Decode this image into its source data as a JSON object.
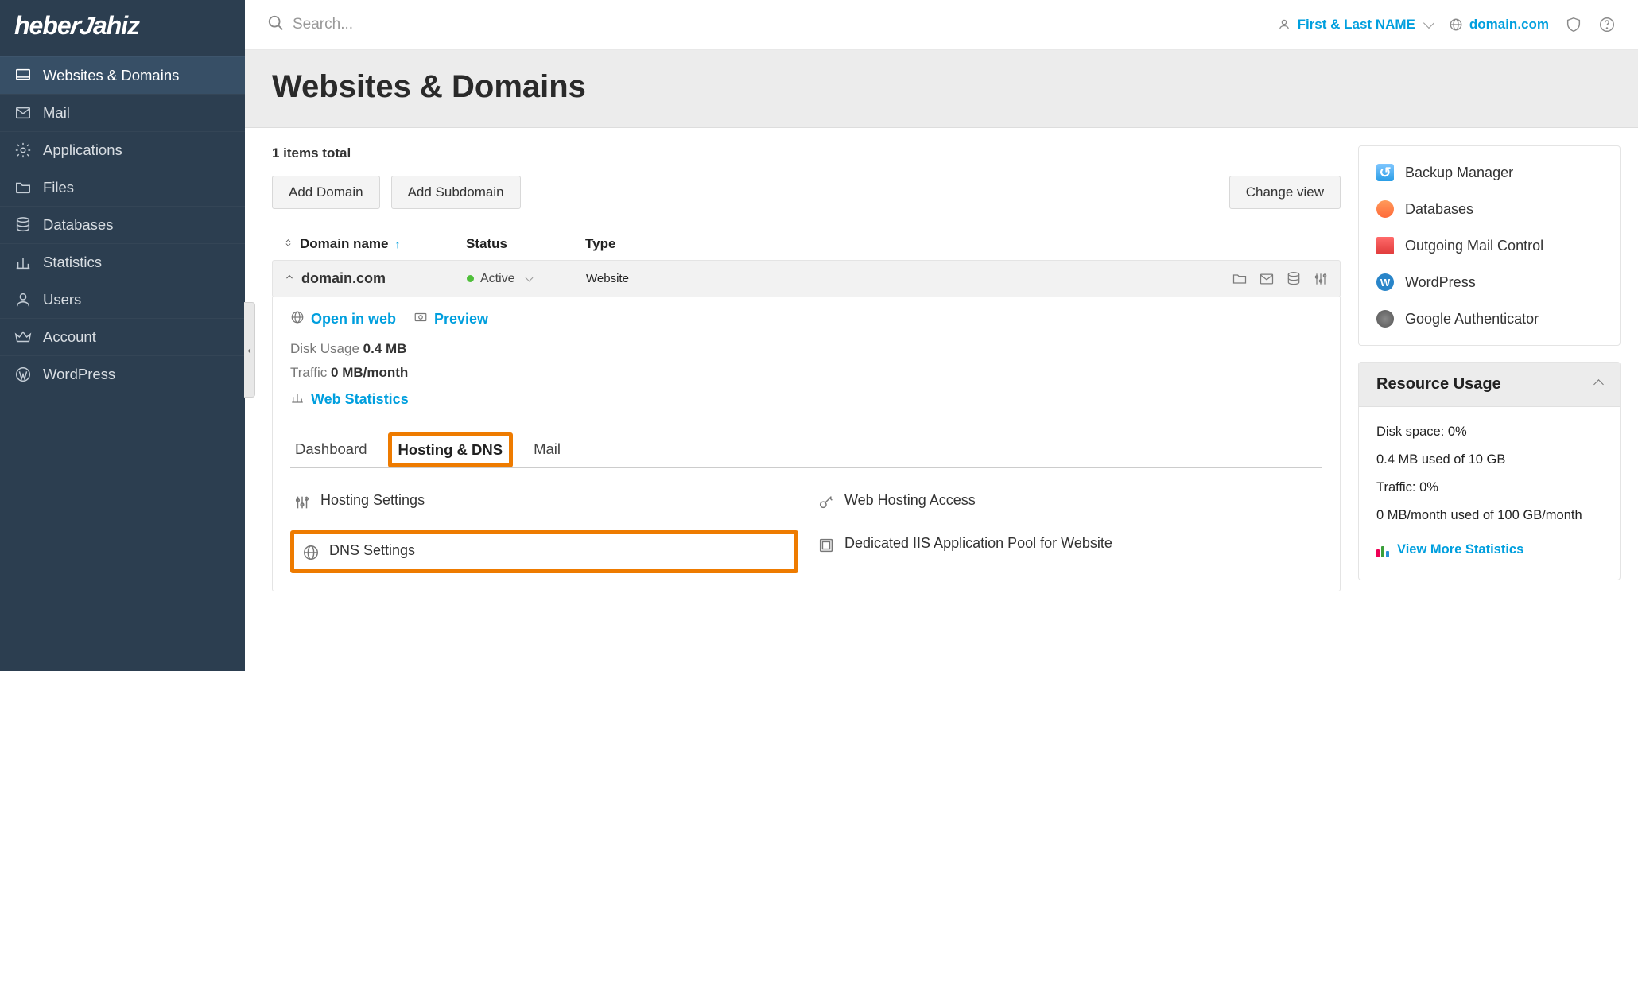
{
  "brand": "heberjahiz",
  "sidebar": {
    "items": [
      {
        "label": "Websites & Domains",
        "icon": "monitor"
      },
      {
        "label": "Mail",
        "icon": "mail"
      },
      {
        "label": "Applications",
        "icon": "gear"
      },
      {
        "label": "Files",
        "icon": "folder"
      },
      {
        "label": "Databases",
        "icon": "database"
      },
      {
        "label": "Statistics",
        "icon": "bars"
      },
      {
        "label": "Users",
        "icon": "user"
      },
      {
        "label": "Account",
        "icon": "crown"
      },
      {
        "label": "WordPress",
        "icon": "wordpress"
      }
    ],
    "active_index": 0
  },
  "topbar": {
    "search_placeholder": "Search...",
    "user_name": "First & Last NAME",
    "domain": "domain.com"
  },
  "page_title": "Websites & Domains",
  "items_total": "1 items total",
  "buttons": {
    "add_domain": "Add Domain",
    "add_subdomain": "Add Subdomain",
    "change_view": "Change view"
  },
  "table": {
    "cols": {
      "domain": "Domain name",
      "status": "Status",
      "type": "Type"
    },
    "row": {
      "domain": "domain.com",
      "status": "Active",
      "type": "Website"
    }
  },
  "detail": {
    "open_in_web": "Open in web",
    "preview": "Preview",
    "disk_usage_label": "Disk Usage",
    "disk_usage_value": "0.4 MB",
    "traffic_label": "Traffic",
    "traffic_value": "0 MB/month",
    "web_stats": "Web Statistics"
  },
  "tabs": [
    "Dashboard",
    "Hosting & DNS",
    "Mail"
  ],
  "tabs_active": 1,
  "settings": [
    {
      "label": "Hosting Settings",
      "icon": "sliders"
    },
    {
      "label": "Web Hosting Access",
      "icon": "key"
    },
    {
      "label": "DNS Settings",
      "icon": "globe",
      "highlight": true
    },
    {
      "label": "Dedicated IIS Application Pool for Website",
      "icon": "windows"
    }
  ],
  "side_links": [
    {
      "label": "Backup Manager"
    },
    {
      "label": "Databases"
    },
    {
      "label": "Outgoing Mail Control"
    },
    {
      "label": "WordPress"
    },
    {
      "label": "Google Authenticator"
    }
  ],
  "resource_panel": {
    "title": "Resource Usage",
    "disk_space": "Disk space: 0%",
    "disk_detail": "0.4 MB used of 10 GB",
    "traffic": "Traffic: 0%",
    "traffic_detail": "0 MB/month used of 100 GB/month",
    "view_more": "View More Statistics"
  }
}
